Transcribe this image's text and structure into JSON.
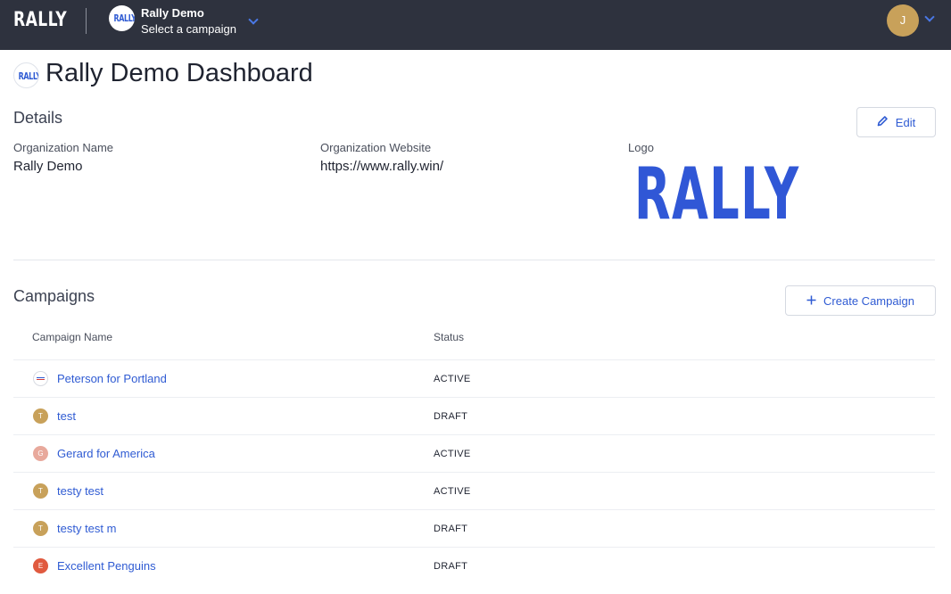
{
  "header": {
    "brand": "RALLY",
    "org_logo_text": "RALLY",
    "org_name": "Rally Demo",
    "org_subtitle": "Select a campaign",
    "user_initial": "J",
    "accent_color": "#2f5bd3",
    "bar_color": "#2e323e"
  },
  "page": {
    "logo_text": "RALLY",
    "title": "Rally Demo Dashboard"
  },
  "details": {
    "title": "Details",
    "edit_label": "Edit",
    "edit_icon": "pencil-icon",
    "fields": [
      {
        "label": "Organization Name",
        "value": "Rally Demo"
      },
      {
        "label": "Organization Website",
        "value": "https://www.rally.win/"
      },
      {
        "label": "Logo",
        "value": "RALLY"
      }
    ]
  },
  "campaigns": {
    "title": "Campaigns",
    "create_label": "Create Campaign",
    "create_icon": "plus-icon",
    "columns": [
      "Campaign Name",
      "Status"
    ],
    "rows": [
      {
        "icon": "flag",
        "initial": "",
        "color": "#ffffff",
        "name": "Peterson for Portland",
        "status": "ACTIVE"
      },
      {
        "icon": "initial",
        "initial": "T",
        "color": "#c8a15a",
        "name": "test",
        "status": "DRAFT"
      },
      {
        "icon": "initial",
        "initial": "G",
        "color": "#e8a99c",
        "name": "Gerard for America",
        "status": "ACTIVE"
      },
      {
        "icon": "initial",
        "initial": "T",
        "color": "#c8a15a",
        "name": "testy test",
        "status": "ACTIVE"
      },
      {
        "icon": "initial",
        "initial": "T",
        "color": "#c8a15a",
        "name": "testy test m",
        "status": "DRAFT"
      },
      {
        "icon": "initial",
        "initial": "E",
        "color": "#e05a3f",
        "name": "Excellent Penguins",
        "status": "DRAFT"
      }
    ]
  }
}
